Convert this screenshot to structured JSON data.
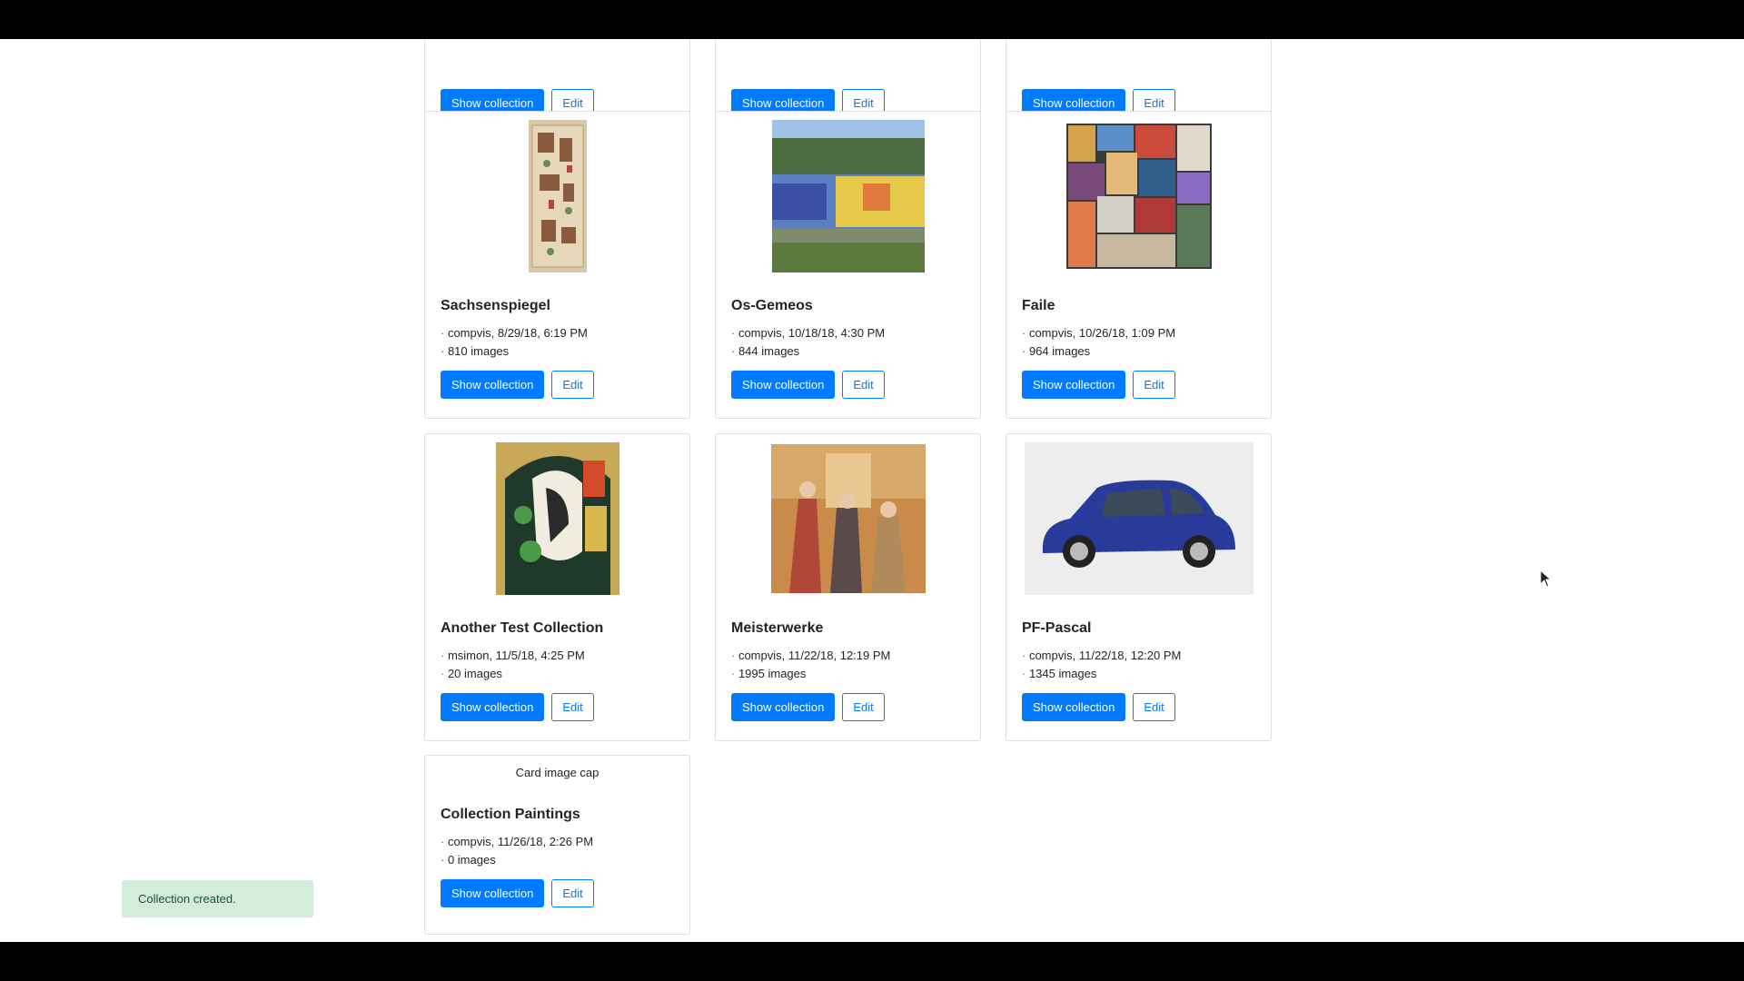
{
  "buttons": {
    "show": "Show collection",
    "edit": "Edit"
  },
  "top_row": [
    {
      "show": "Show collection",
      "edit": "Edit"
    },
    {
      "show": "Show collection",
      "edit": "Edit"
    },
    {
      "show": "Show collection",
      "edit": "Edit"
    }
  ],
  "collections": [
    {
      "title": "Sachsenspiegel",
      "meta": "compvis, 8/29/18, 6:19 PM",
      "count": "810 images",
      "image": "manuscript-thumbnail"
    },
    {
      "title": "Os-Gemeos",
      "meta": "compvis, 10/18/18, 4:30 PM",
      "count": "844 images",
      "image": "graffiti-train-thumbnail"
    },
    {
      "title": "Faile",
      "meta": "compvis, 10/26/18, 1:09 PM",
      "count": "964 images",
      "image": "collage-thumbnail"
    },
    {
      "title": "Another Test Collection",
      "meta": "msimon, 11/5/18, 4:25 PM",
      "count": "20 images",
      "image": "cubist-portrait-thumbnail"
    },
    {
      "title": "Meisterwerke",
      "meta": "compvis, 11/22/18, 12:19 PM",
      "count": "1995 images",
      "image": "renaissance-painting-thumbnail"
    },
    {
      "title": "PF-Pascal",
      "meta": "compvis, 11/22/18, 12:20 PM",
      "count": "1345 images",
      "image": "blue-car-thumbnail"
    },
    {
      "title": "Collection Paintings",
      "meta": "compvis, 11/26/18, 2:26 PM",
      "count": "0 images",
      "image_alt": "Card image cap"
    }
  ],
  "toast": {
    "message": "Collection created."
  },
  "colors": {
    "primary": "#007bff",
    "toast_bg": "#d4edda",
    "toast_text": "#155724",
    "frame": "#000000"
  }
}
